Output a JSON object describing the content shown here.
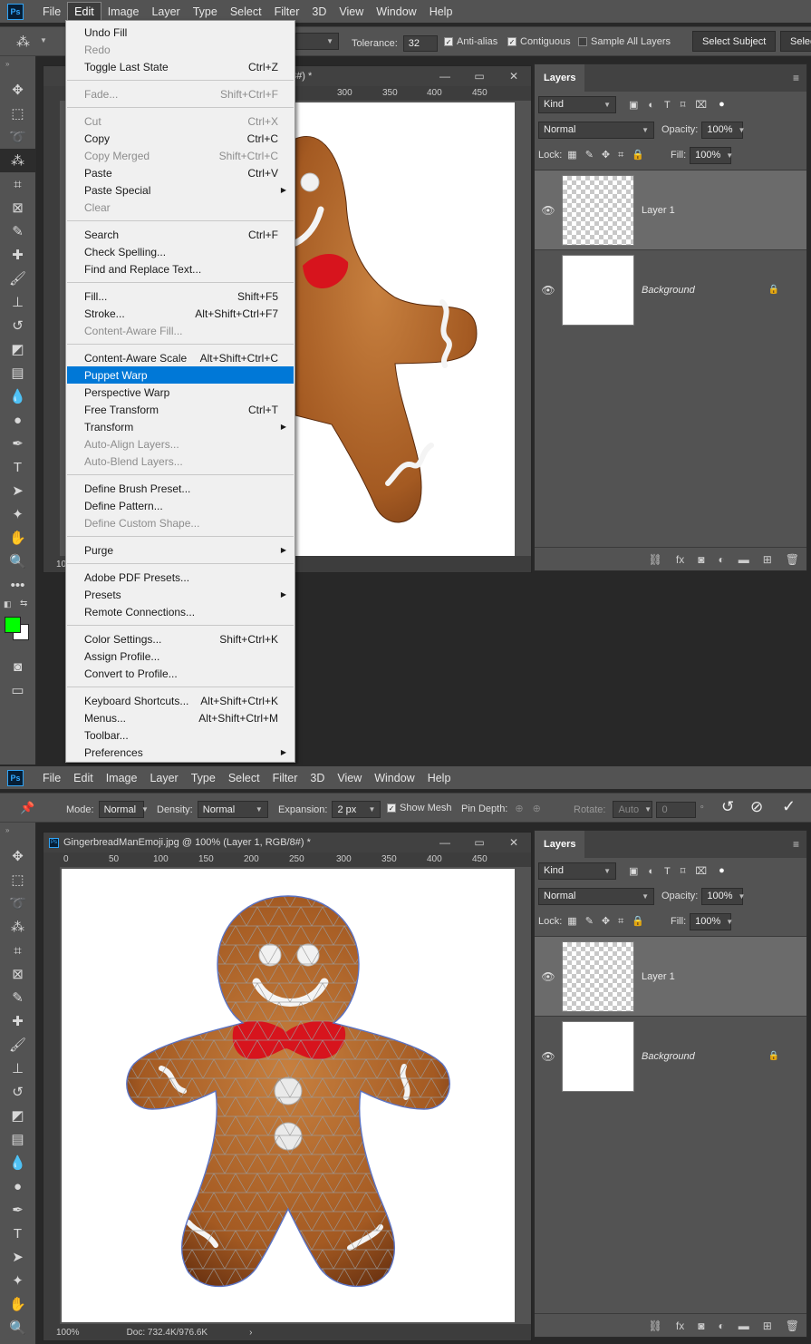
{
  "app_logo": "Ps",
  "menubar": [
    "File",
    "Edit",
    "Image",
    "Layer",
    "Type",
    "Select",
    "Filter",
    "3D",
    "View",
    "Window",
    "Help"
  ],
  "top": {
    "options": {
      "tolerance_label": "Tolerance:",
      "tolerance_value": "32",
      "antialias": "Anti-alias",
      "contiguous": "Contiguous",
      "sample_all": "Sample All Layers",
      "select_subject": "Select Subject",
      "select_cut": "Selec"
    },
    "doc_tab": "/8#) *",
    "ruler_ticks": [
      "300",
      "350",
      "400",
      "450"
    ],
    "status_zoom": "10",
    "menu": [
      {
        "label": "Undo Fill",
        "shortcut": "",
        "dis": false
      },
      {
        "label": "Redo",
        "shortcut": "",
        "dis": true
      },
      {
        "label": "Toggle Last State",
        "shortcut": "Ctrl+Z",
        "dis": false
      },
      {
        "sep": true
      },
      {
        "label": "Fade...",
        "shortcut": "Shift+Ctrl+F",
        "dis": true
      },
      {
        "sep": true
      },
      {
        "label": "Cut",
        "shortcut": "Ctrl+X",
        "dis": true
      },
      {
        "label": "Copy",
        "shortcut": "Ctrl+C",
        "dis": false
      },
      {
        "label": "Copy Merged",
        "shortcut": "Shift+Ctrl+C",
        "dis": true
      },
      {
        "label": "Paste",
        "shortcut": "Ctrl+V",
        "dis": false
      },
      {
        "label": "Paste Special",
        "shortcut": "",
        "dis": false,
        "sub": true
      },
      {
        "label": "Clear",
        "shortcut": "",
        "dis": true
      },
      {
        "sep": true
      },
      {
        "label": "Search",
        "shortcut": "Ctrl+F",
        "dis": false
      },
      {
        "label": "Check Spelling...",
        "shortcut": "",
        "dis": false
      },
      {
        "label": "Find and Replace Text...",
        "shortcut": "",
        "dis": false
      },
      {
        "sep": true
      },
      {
        "label": "Fill...",
        "shortcut": "Shift+F5",
        "dis": false
      },
      {
        "label": "Stroke...",
        "shortcut": "Alt+Shift+Ctrl+F7",
        "dis": false
      },
      {
        "label": "Content-Aware Fill...",
        "shortcut": "",
        "dis": true
      },
      {
        "sep": true
      },
      {
        "label": "Content-Aware Scale",
        "shortcut": "Alt+Shift+Ctrl+C",
        "dis": false
      },
      {
        "label": "Puppet Warp",
        "shortcut": "",
        "dis": false,
        "hl": true
      },
      {
        "label": "Perspective Warp",
        "shortcut": "",
        "dis": false
      },
      {
        "label": "Free Transform",
        "shortcut": "Ctrl+T",
        "dis": false
      },
      {
        "label": "Transform",
        "shortcut": "",
        "dis": false,
        "sub": true
      },
      {
        "label": "Auto-Align Layers...",
        "shortcut": "",
        "dis": true
      },
      {
        "label": "Auto-Blend Layers...",
        "shortcut": "",
        "dis": true
      },
      {
        "sep": true
      },
      {
        "label": "Define Brush Preset...",
        "shortcut": "",
        "dis": false
      },
      {
        "label": "Define Pattern...",
        "shortcut": "",
        "dis": false
      },
      {
        "label": "Define Custom Shape...",
        "shortcut": "",
        "dis": true
      },
      {
        "sep": true
      },
      {
        "label": "Purge",
        "shortcut": "",
        "dis": false,
        "sub": true
      },
      {
        "sep": true
      },
      {
        "label": "Adobe PDF Presets...",
        "shortcut": "",
        "dis": false
      },
      {
        "label": "Presets",
        "shortcut": "",
        "dis": false,
        "sub": true
      },
      {
        "label": "Remote Connections...",
        "shortcut": "",
        "dis": false
      },
      {
        "sep": true
      },
      {
        "label": "Color Settings...",
        "shortcut": "Shift+Ctrl+K",
        "dis": false
      },
      {
        "label": "Assign Profile...",
        "shortcut": "",
        "dis": false
      },
      {
        "label": "Convert to Profile...",
        "shortcut": "",
        "dis": false
      },
      {
        "sep": true
      },
      {
        "label": "Keyboard Shortcuts...",
        "shortcut": "Alt+Shift+Ctrl+K",
        "dis": false
      },
      {
        "label": "Menus...",
        "shortcut": "Alt+Shift+Ctrl+M",
        "dis": false
      },
      {
        "label": "Toolbar...",
        "shortcut": "",
        "dis": false
      },
      {
        "label": "Preferences",
        "shortcut": "",
        "dis": false,
        "sub": true
      }
    ]
  },
  "bottom": {
    "options": {
      "mode_label": "Mode:",
      "mode_value": "Normal",
      "density_label": "Density:",
      "density_value": "Normal",
      "expansion_label": "Expansion:",
      "expansion_value": "2 px",
      "show_mesh": "Show Mesh",
      "pin_depth": "Pin Depth:",
      "rotate_label": "Rotate:",
      "rotate_value": "Auto",
      "rotate_angle": "0",
      "degree": "°"
    },
    "doc_tab": "GingerbreadManEmoji.jpg @ 100% (Layer 1, RGB/8#) *",
    "ruler_ticks": [
      "0",
      "50",
      "100",
      "150",
      "200",
      "250",
      "300",
      "350",
      "400",
      "450"
    ],
    "status_zoom": "100%",
    "status_doc": "Doc: 732.4K/976.6K"
  },
  "layers": {
    "tab": "Layers",
    "kind": "Kind",
    "blend": "Normal",
    "opacity_label": "Opacity:",
    "opacity_value": "100%",
    "lock_label": "Lock:",
    "fill_label": "Fill:",
    "fill_value": "100%",
    "rows": [
      {
        "name": "Layer 1"
      },
      {
        "name": "Background"
      }
    ]
  },
  "colors": {
    "foreground": "#00ff00",
    "background": "#ffffff",
    "highlight": "#0078d7"
  }
}
